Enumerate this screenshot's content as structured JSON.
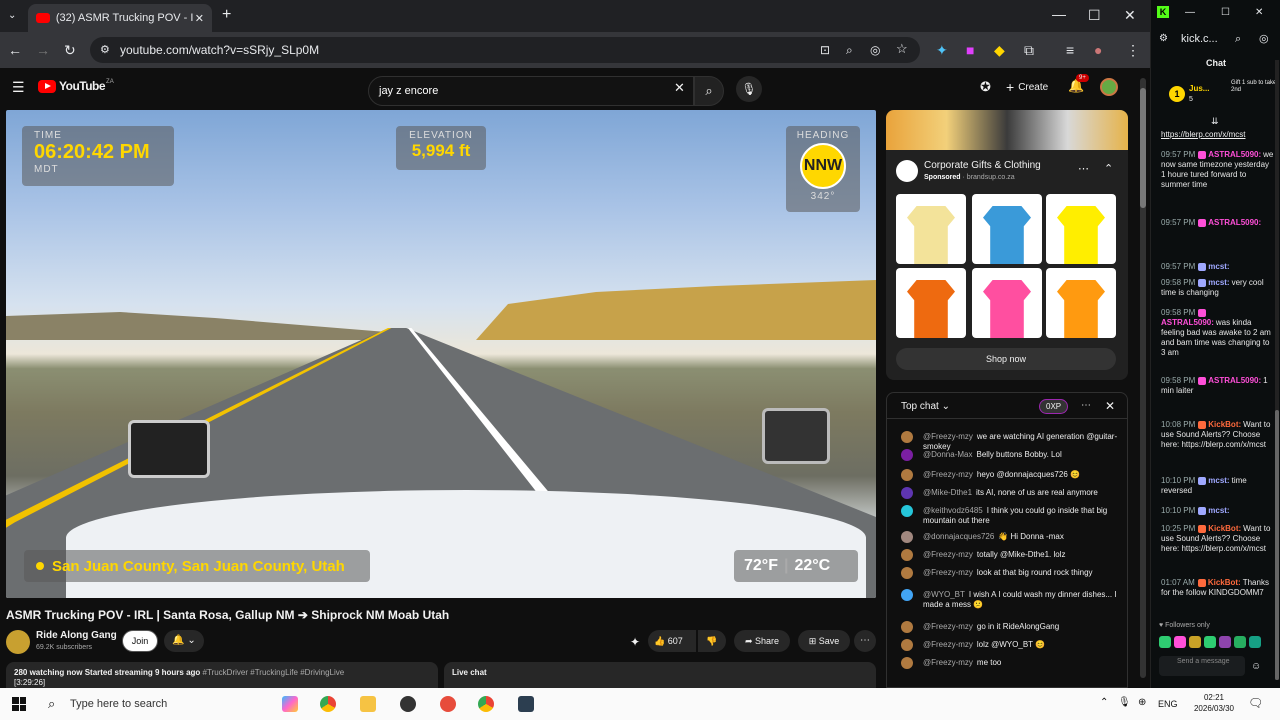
{
  "browser": {
    "tab_title": "(32) ASMR Trucking POV - I",
    "url": "youtube.com/watch?v=sSRjy_SLp0M"
  },
  "youtube": {
    "logo_text": "YouTube",
    "logo_badge": "ZA",
    "search_value": "jay z encore",
    "create_label": "Create",
    "notifications_count": "9+",
    "video": {
      "time_label": "TIME",
      "time_value": "06:20:42 PM",
      "time_zone": "MDT",
      "elevation_label": "ELEVATION",
      "elevation_value": "5,994 ft",
      "heading_label": "HEADING",
      "heading_value": "NNW",
      "heading_degrees": "342°",
      "location": "San Juan County, San Juan County, Utah",
      "temp_f": "72°F",
      "temp_sep": "|",
      "temp_c": "22°C"
    },
    "title": "ASMR Trucking POV - IRL | Santa Rosa, Gallup NM ➔ Shiprock NM Moab Utah",
    "channel_name": "Ride Along Gang",
    "subscribers": "69.2K subscribers",
    "join_label": "Join",
    "like_count": "607",
    "share_label": "Share",
    "save_label": "Save",
    "watching": "280 watching now",
    "started": "Started streaming 9 hours ago",
    "hashtags": "#TruckDriver #TruckingLife #DrivingLive",
    "timestamp": "[3:29:26]",
    "live_chat_label": "Live chat",
    "ad": {
      "title": "Corporate Gifts & Clothing",
      "sponsored": "Sponsored",
      "domain": "brandsup.co.za",
      "shop_now": "Shop now",
      "shirt_colors": [
        "#f3e39a",
        "#3a9ad9",
        "#ffee00",
        "#ee6a10",
        "#ff4fa0",
        "#ff9a10"
      ]
    },
    "chat": {
      "header": "Top chat",
      "xp": "0XP",
      "messages": [
        {
          "author": "@Freezy-mzy",
          "text": "we are watching AI generation @guitar-smokey",
          "color": "#b07a40"
        },
        {
          "author": "@Donna-Max",
          "text": "Belly buttons Bobby. Lol",
          "color": "#7b1fa2"
        },
        {
          "author": "@Freezy-mzy",
          "text": "heyo @donnajacques726 😊",
          "color": "#b07a40"
        },
        {
          "author": "@Mike-Dthe1",
          "text": "its AI, none of us are real anymore",
          "color": "#5e35b1"
        },
        {
          "author": "@keithvodz6485",
          "text": "I think you could go inside that big mountain out there",
          "color": "#26c6da"
        },
        {
          "author": "@donnajacques726",
          "text": "👋 Hi Donna -max",
          "color": "#a1887f"
        },
        {
          "author": "@Freezy-mzy",
          "text": "totally @Mike-Dthe1. lolz",
          "color": "#b07a40"
        },
        {
          "author": "@Freezy-mzy",
          "text": "look at that big round rock thingy",
          "color": "#b07a40"
        },
        {
          "author": "@WYO_BT",
          "text": "I wish A I could wash my dinner dishes... I made a mess 😕",
          "color": "#42a5f5"
        },
        {
          "author": "@Freezy-mzy",
          "text": "go in it RideAlongGang",
          "color": "#b07a40"
        },
        {
          "author": "@Freezy-mzy",
          "text": "lolz @WYO_BT 😊",
          "color": "#b07a40"
        },
        {
          "author": "@Freezy-mzy",
          "text": "me too",
          "color": "#b07a40"
        }
      ]
    }
  },
  "kick": {
    "url": "kick.c...",
    "chat_title": "Chat",
    "pinned_user": "Jus...",
    "pinned_count": "5",
    "pinned_text": "Gift 1 sub to take 2nd",
    "top_link": "https://blerp.com/x/mcst",
    "messages": [
      {
        "time": "09:57 PM",
        "author": "ASTRAL5090:",
        "text": "we now same timezone yesterday 1 houre tured forward to summer time",
        "color": "#ff4fd8"
      },
      {
        "time": "09:57 PM",
        "author": "ASTRAL5090:",
        "text": "",
        "color": "#ff4fd8"
      },
      {
        "time": "09:57 PM",
        "author": "mcst:",
        "text": "",
        "color": "#9fa8ff"
      },
      {
        "time": "09:58 PM",
        "author": "mcst:",
        "text": "very cool time is changing",
        "color": "#9fa8ff"
      },
      {
        "time": "09:58 PM",
        "author": "ASTRAL5090:",
        "text": "was kinda feeling bad was awake to 2 am and bam time was changing to 3 am",
        "color": "#ff4fd8"
      },
      {
        "time": "09:58 PM",
        "author": "ASTRAL5090:",
        "text": "1 min laiter",
        "color": "#ff4fd8"
      },
      {
        "time": "10:08 PM",
        "author": "KickBot:",
        "text": "Want to use Sound Alerts?? Choose here: https://blerp.com/x/mcst",
        "color": "#ff6a3d"
      },
      {
        "time": "10:10 PM",
        "author": "mcst:",
        "text": "time reversed",
        "color": "#9fa8ff"
      },
      {
        "time": "10:10 PM",
        "author": "mcst:",
        "text": "",
        "color": "#9fa8ff"
      },
      {
        "time": "10:25 PM",
        "author": "KickBot:",
        "text": "Want to use Sound Alerts?? Choose here: https://blerp.com/x/mcst",
        "color": "#ff6a3d"
      },
      {
        "time": "01:07 AM",
        "author": "KickBot:",
        "text": "Thanks for the follow KINDGDOMM7",
        "color": "#ff6a3d"
      }
    ],
    "followers_only": "Followers only",
    "send_placeholder": "Send a message"
  },
  "taskbar": {
    "search_placeholder": "Type here to search",
    "language": "ENG",
    "time": "02:21",
    "date": "2026/03/30"
  }
}
